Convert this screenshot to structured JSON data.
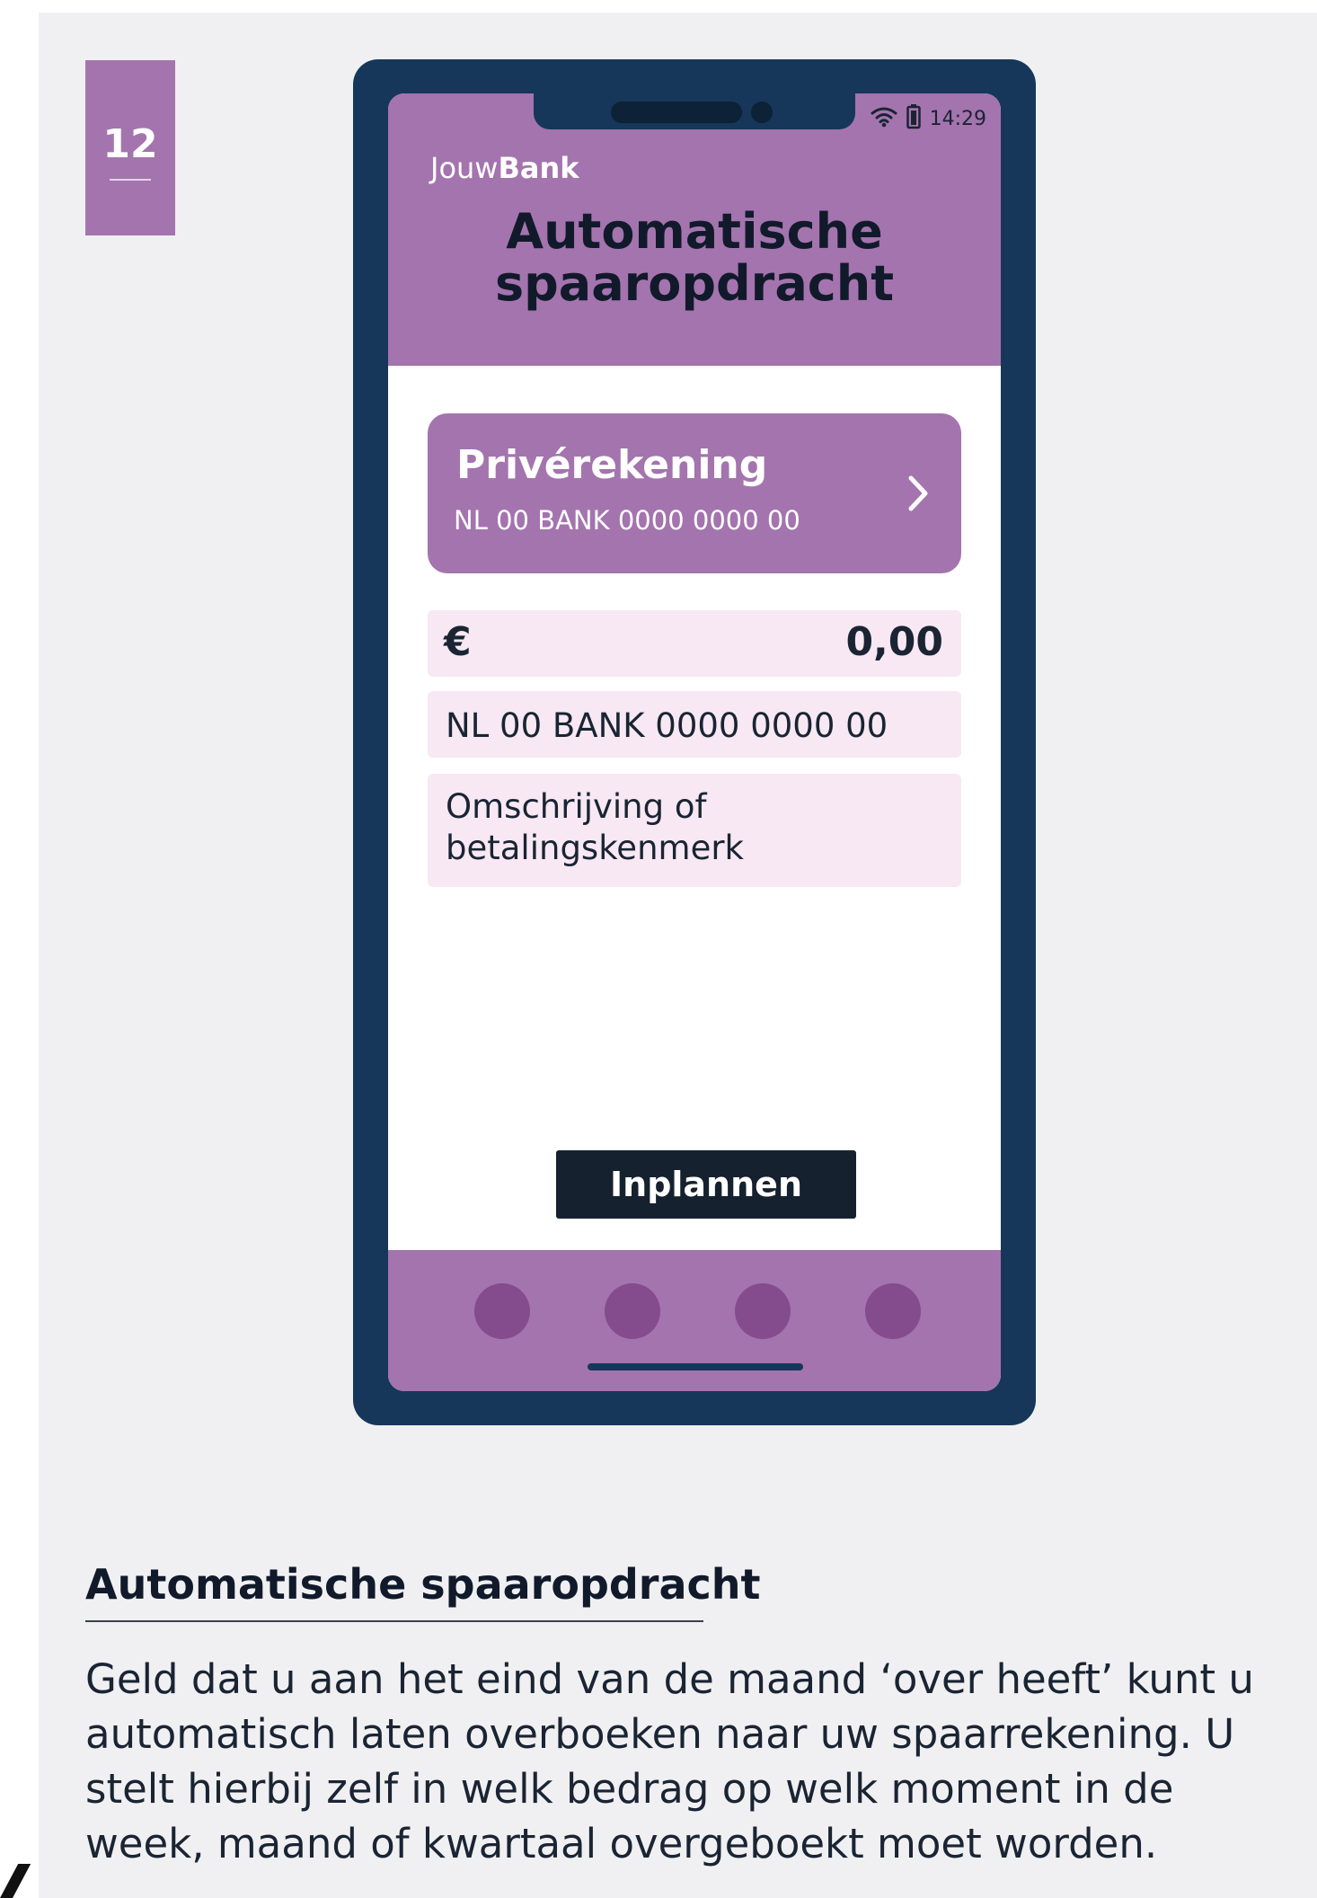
{
  "page_number": "12",
  "phone": {
    "status": {
      "time": "14:29"
    },
    "brand": {
      "prefix": "Jouw",
      "bold": "Bank"
    },
    "title": "Automatische spaaropdracht",
    "account": {
      "name": "Privérekening",
      "iban": "NL 00 BANK 0000 0000 00"
    },
    "amount": {
      "currency": "€",
      "value": "0,00"
    },
    "to_account_value": "NL 00 BANK 0000 0000 00",
    "description_placeholder": "Omschrijving of betalingskenmerk",
    "submit_label": "Inplannen"
  },
  "caption": {
    "title": "Automatische spaaropdracht",
    "body": "Geld dat u aan het eind van de maand ‘over heeft’ kunt u automatisch laten overboeken naar uw spaarrekening. U stelt hierbij zelf in welk bedrag op welk moment in de week, maand of kwartaal overgeboekt moet worden."
  },
  "colors": {
    "accent": "#a474ae",
    "phone_frame": "#163759",
    "field_bg": "#f7e8f3",
    "button": "#15212f",
    "nav_dot": "#854c8d"
  }
}
